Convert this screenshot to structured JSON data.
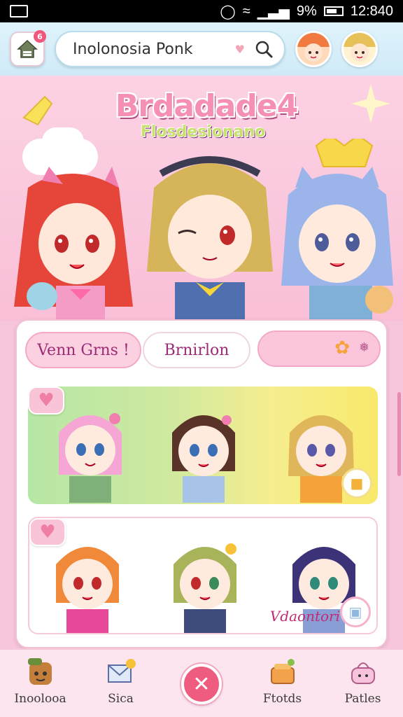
{
  "status_bar": {
    "battery_percent": "9%",
    "time": "12:840"
  },
  "top_bar": {
    "home_badge": "6",
    "search": {
      "value": "Inolonosia Ponk",
      "placeholder": ""
    }
  },
  "hero": {
    "title": "Brdadade4",
    "subtitle": "Flosdesionano"
  },
  "tabs": [
    {
      "label": "Venn Grns !"
    },
    {
      "label": "Brnirlon"
    },
    {
      "label": ""
    }
  ],
  "panels": {
    "second_label": "Vdaontori"
  },
  "bottom_nav": {
    "items": [
      {
        "label": "Inoolooa",
        "icon": "character-icon"
      },
      {
        "label": "Sica",
        "icon": "envelope-icon"
      },
      {
        "label": "Ftotds",
        "icon": "basket-icon"
      },
      {
        "label": "Patles",
        "icon": "bag-icon"
      }
    ]
  },
  "colors": {
    "accent_pink": "#ee5c7f",
    "bg_pink": "#f7c6dc",
    "top_bar_blue": "#dff3fb"
  }
}
